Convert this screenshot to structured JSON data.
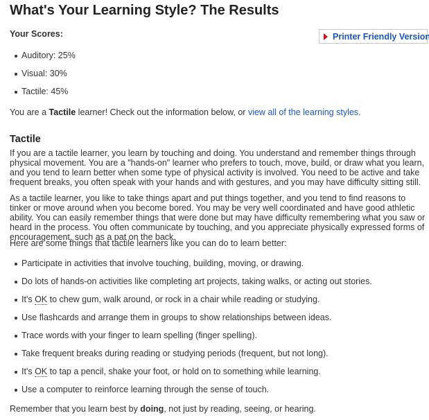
{
  "header": {
    "title": "What's Your Learning Style? The Results"
  },
  "scores": {
    "heading": "Your Scores:",
    "items": [
      "Auditory: 25%",
      "Visual: 30%",
      "Tactile: 45%"
    ]
  },
  "printer_button": {
    "label": "Printer Friendly Version"
  },
  "result": {
    "prefix": "You are a ",
    "style": "Tactile",
    "middle": " learner! Check out the information below, or ",
    "link_text": "view all of the learning styles",
    "suffix": "."
  },
  "section": {
    "title": "Tactile",
    "paragraph1": "If you are a tactile learner, you learn by touching and doing. You understand and remember things through physical movement. You are a \"hands-on\" learner who prefers to touch, move, build, or draw what you learn, and you tend to learn better when some type of physical activity is involved. You need to be active and take frequent breaks, you often speak with your hands and with gestures, and you may have difficulty sitting still.",
    "paragraph2": "As a tactile learner, you like to take things apart and put things together, and you tend to find reasons to tinker or move around when you become bored. You may be very well coordinated and have good athletic ability. You can easily remember things that were done but may have difficulty remembering what you saw or heard in the process. You often communicate by touching, and you appreciate physically expressed forms of encouragement, such as a pat on the back.",
    "tips_intro": "Here are some things that tactile learners like you can do to learn better:",
    "tips": [
      "Participate in activities that involve touching, building, moving, or drawing.",
      "Do lots of hands-on activities like completing art projects, taking walks, or acting out stories.",
      "to chew gum, walk around, or rock in a chair while reading or studying.",
      "Use flashcards and arrange them in groups to show relationships between ideas.",
      "Trace words with your finger to learn spelling (finger spelling).",
      "Take frequent breaks during reading or studying periods (frequent, but not long).",
      "to tap a pencil, shake your foot, or hold on to something while learning.",
      "Use a computer to reinforce learning through the sense of touch."
    ],
    "its_prefix": "It's ",
    "ok_abbr": "OK",
    "closing_prefix": "Remember that you learn best by ",
    "closing_bold": "doing",
    "closing_suffix": ", not just by reading, seeing, or hearing."
  }
}
